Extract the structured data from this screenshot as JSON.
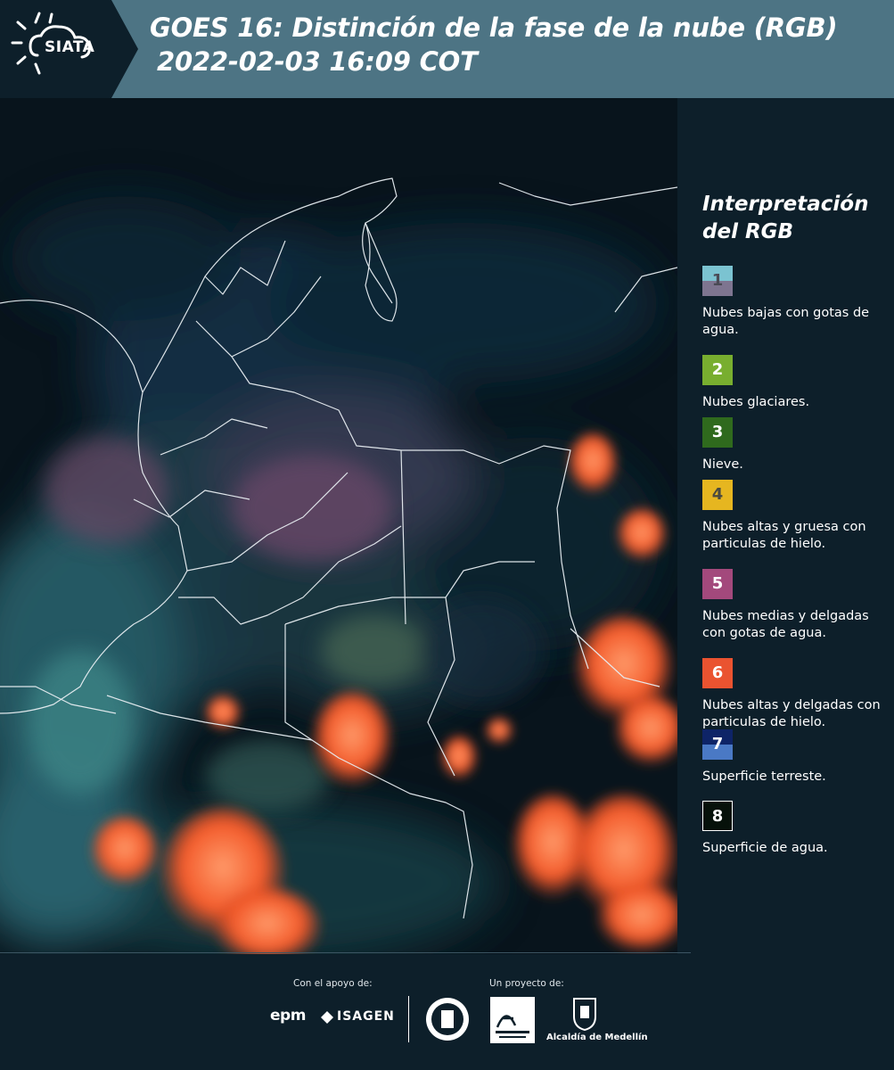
{
  "header": {
    "logo_text": "SIATA",
    "title_line1": "GOES 16: Distinción de la fase de la nube (RGB)",
    "title_line2": "2022-02-03 16:09 COT"
  },
  "legend": {
    "title_line1": "Interpretación",
    "title_line2": "del RGB",
    "items": [
      {
        "number": "1",
        "text": "Nubes bajas con gotas de agua.",
        "color_top": "#7bc3d1",
        "color_bottom": "#7e7590",
        "num_color": "#4a4a55"
      },
      {
        "number": "2",
        "text": "Nubes glaciares.",
        "color_top": "#78ae2f",
        "num_color": "#ffffff"
      },
      {
        "number": "3",
        "text": "Nieve.",
        "color_top": "#2f6a1d",
        "num_color": "#ffffff"
      },
      {
        "number": "4",
        "text": "Nubes altas y gruesa con particulas de hielo.",
        "color_top": "#e6b620",
        "num_color": "#4a4a40"
      },
      {
        "number": "5",
        "text": "Nubes medias y delgadas con gotas de agua.",
        "color_top": "#a3497c",
        "num_color": "#ffffff"
      },
      {
        "number": "6",
        "text": "Nubes altas y delgadas con particulas de hielo.",
        "color_top": "#ea5330",
        "num_color": "#ffffff"
      },
      {
        "number": "7",
        "text": "Superficie terreste.",
        "color_top": "#0e2467",
        "color_bottom": "#4a79c5",
        "num_color": "#ffffff"
      },
      {
        "number": "8",
        "text": "Superficie de agua.",
        "color_top": "#06110a",
        "num_color": "#ffffff"
      }
    ]
  },
  "footer": {
    "support_label": "Con el apoyo de:",
    "project_label": "Un proyecto de:",
    "epm": "epm",
    "isagen": "ISAGEN",
    "alcaldia": "Alcaldía de Medellín"
  }
}
